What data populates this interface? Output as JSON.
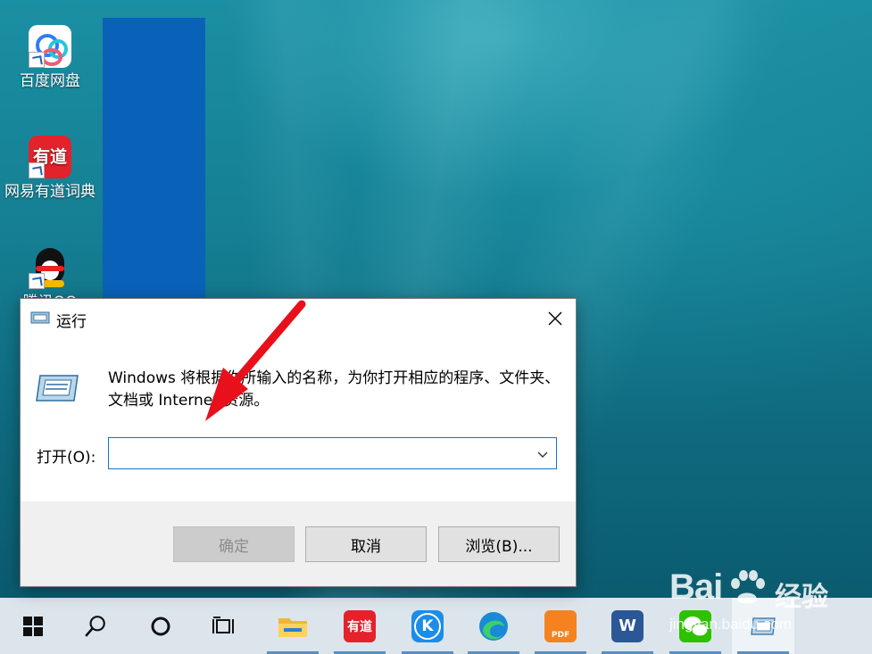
{
  "desktop": {
    "icons": [
      {
        "label": "百度网盘",
        "icon": "baidu-netdisk-icon"
      },
      {
        "label": "网易有道词典",
        "icon": "youdao-dict-icon",
        "glyph": "有道"
      },
      {
        "label": "腾讯QQ",
        "icon": "qq-icon"
      }
    ]
  },
  "run_dialog": {
    "title": "运行",
    "description": "Windows 将根据你所输入的名称，为你打开相应的程序、文件夹、文档或 Internet 资源。",
    "open_label": "打开(O):",
    "input_value": "",
    "buttons": {
      "ok": "确定",
      "cancel": "取消",
      "browse": "浏览(B)..."
    }
  },
  "taskbar": {
    "items": [
      {
        "name": "start",
        "icon": "windows-logo-icon"
      },
      {
        "name": "search",
        "icon": "search-icon"
      },
      {
        "name": "cortana",
        "icon": "cortana-circle-icon"
      },
      {
        "name": "task-view",
        "icon": "task-view-icon"
      },
      {
        "name": "file-explorer",
        "icon": "folder-icon"
      },
      {
        "name": "youdao",
        "icon": "youdao-icon",
        "glyph": "有道"
      },
      {
        "name": "kugou",
        "icon": "kugou-icon",
        "glyph": "K"
      },
      {
        "name": "edge",
        "icon": "edge-icon"
      },
      {
        "name": "foxit-pdf",
        "icon": "pdf-icon",
        "glyph": "PDF"
      },
      {
        "name": "word",
        "icon": "word-icon",
        "glyph": "W"
      },
      {
        "name": "wechat",
        "icon": "wechat-icon"
      },
      {
        "name": "run",
        "icon": "run-icon"
      }
    ]
  },
  "watermark": {
    "brand": "Bai",
    "brand_suffix": "经验",
    "url": "jingyan.baidu.com"
  },
  "colors": {
    "accent": "#1a73c9",
    "arrow": "#e8101a",
    "taskbar_bg": "#dce5ec"
  }
}
